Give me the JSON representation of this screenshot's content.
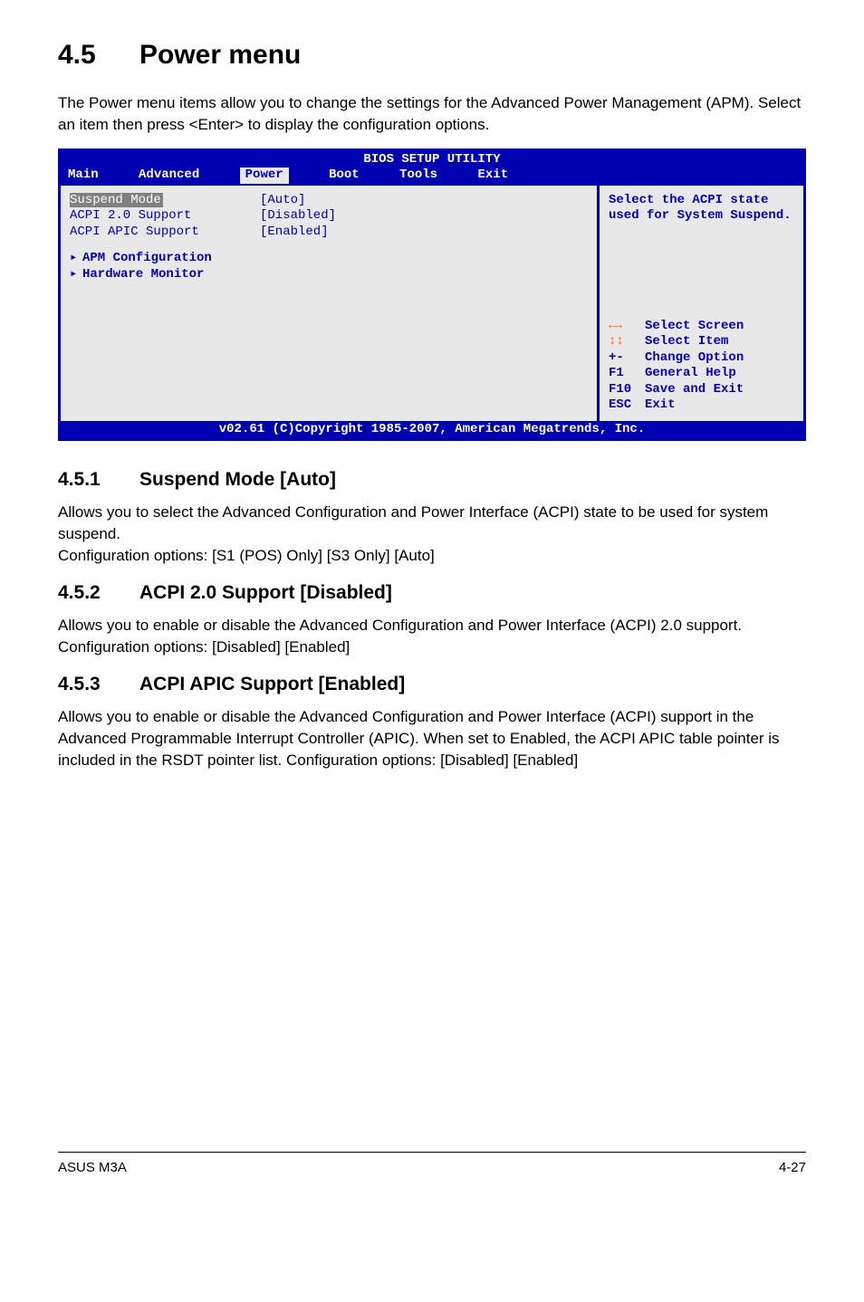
{
  "section": {
    "number": "4.5",
    "title": "Power menu",
    "intro": "The Power menu items allow you to change the settings for the Advanced Power Management (APM). Select an item then press <Enter> to display the configuration options."
  },
  "bios": {
    "title": "BIOS SETUP UTILITY",
    "tabs": [
      "Main",
      "Advanced",
      "Power",
      "Boot",
      "Tools",
      "Exit"
    ],
    "active_tab_index": 2,
    "items": [
      {
        "label": "Suspend Mode",
        "value": "[Auto]"
      },
      {
        "label": "ACPI 2.0 Support",
        "value": "[Disabled]"
      },
      {
        "label": "ACPI APIC Support",
        "value": "[Enabled]"
      }
    ],
    "submenus": [
      "APM Configuration",
      "Hardware Monitor"
    ],
    "help_text": "Select the ACPI state used for System Suspend.",
    "hints": [
      {
        "key_glyph": "lr",
        "label": "Select Screen"
      },
      {
        "key_glyph": "ud",
        "label": "Select Item"
      },
      {
        "key": "+-",
        "label": "Change Option"
      },
      {
        "key": "F1",
        "label": "General Help"
      },
      {
        "key": "F10",
        "label": "Save and Exit"
      },
      {
        "key": "ESC",
        "label": "Exit"
      }
    ],
    "footer": "v02.61 (C)Copyright 1985-2007, American Megatrends, Inc."
  },
  "subs": [
    {
      "num": "4.5.1",
      "title": "Suspend Mode [Auto]",
      "paras": [
        "Allows you to select the Advanced Configuration and Power Interface (ACPI) state to be used for system suspend.",
        "Configuration options: [S1 (POS) Only] [S3 Only] [Auto]"
      ]
    },
    {
      "num": "4.5.2",
      "title": "ACPI 2.0 Support [Disabled]",
      "paras": [
        "Allows you to enable or disable the Advanced Configuration and Power Interface (ACPI) 2.0 support. Configuration options: [Disabled] [Enabled]"
      ]
    },
    {
      "num": "4.5.3",
      "title": "ACPI APIC Support [Enabled]",
      "paras": [
        "Allows you to enable or disable the Advanced Configuration and Power Interface (ACPI) support in the Advanced Programmable Interrupt Controller (APIC). When set to Enabled, the ACPI APIC table pointer is included in the RSDT pointer list. Configuration options: [Disabled] [Enabled]"
      ]
    }
  ],
  "footer": {
    "left": "ASUS M3A",
    "right": "4-27"
  }
}
